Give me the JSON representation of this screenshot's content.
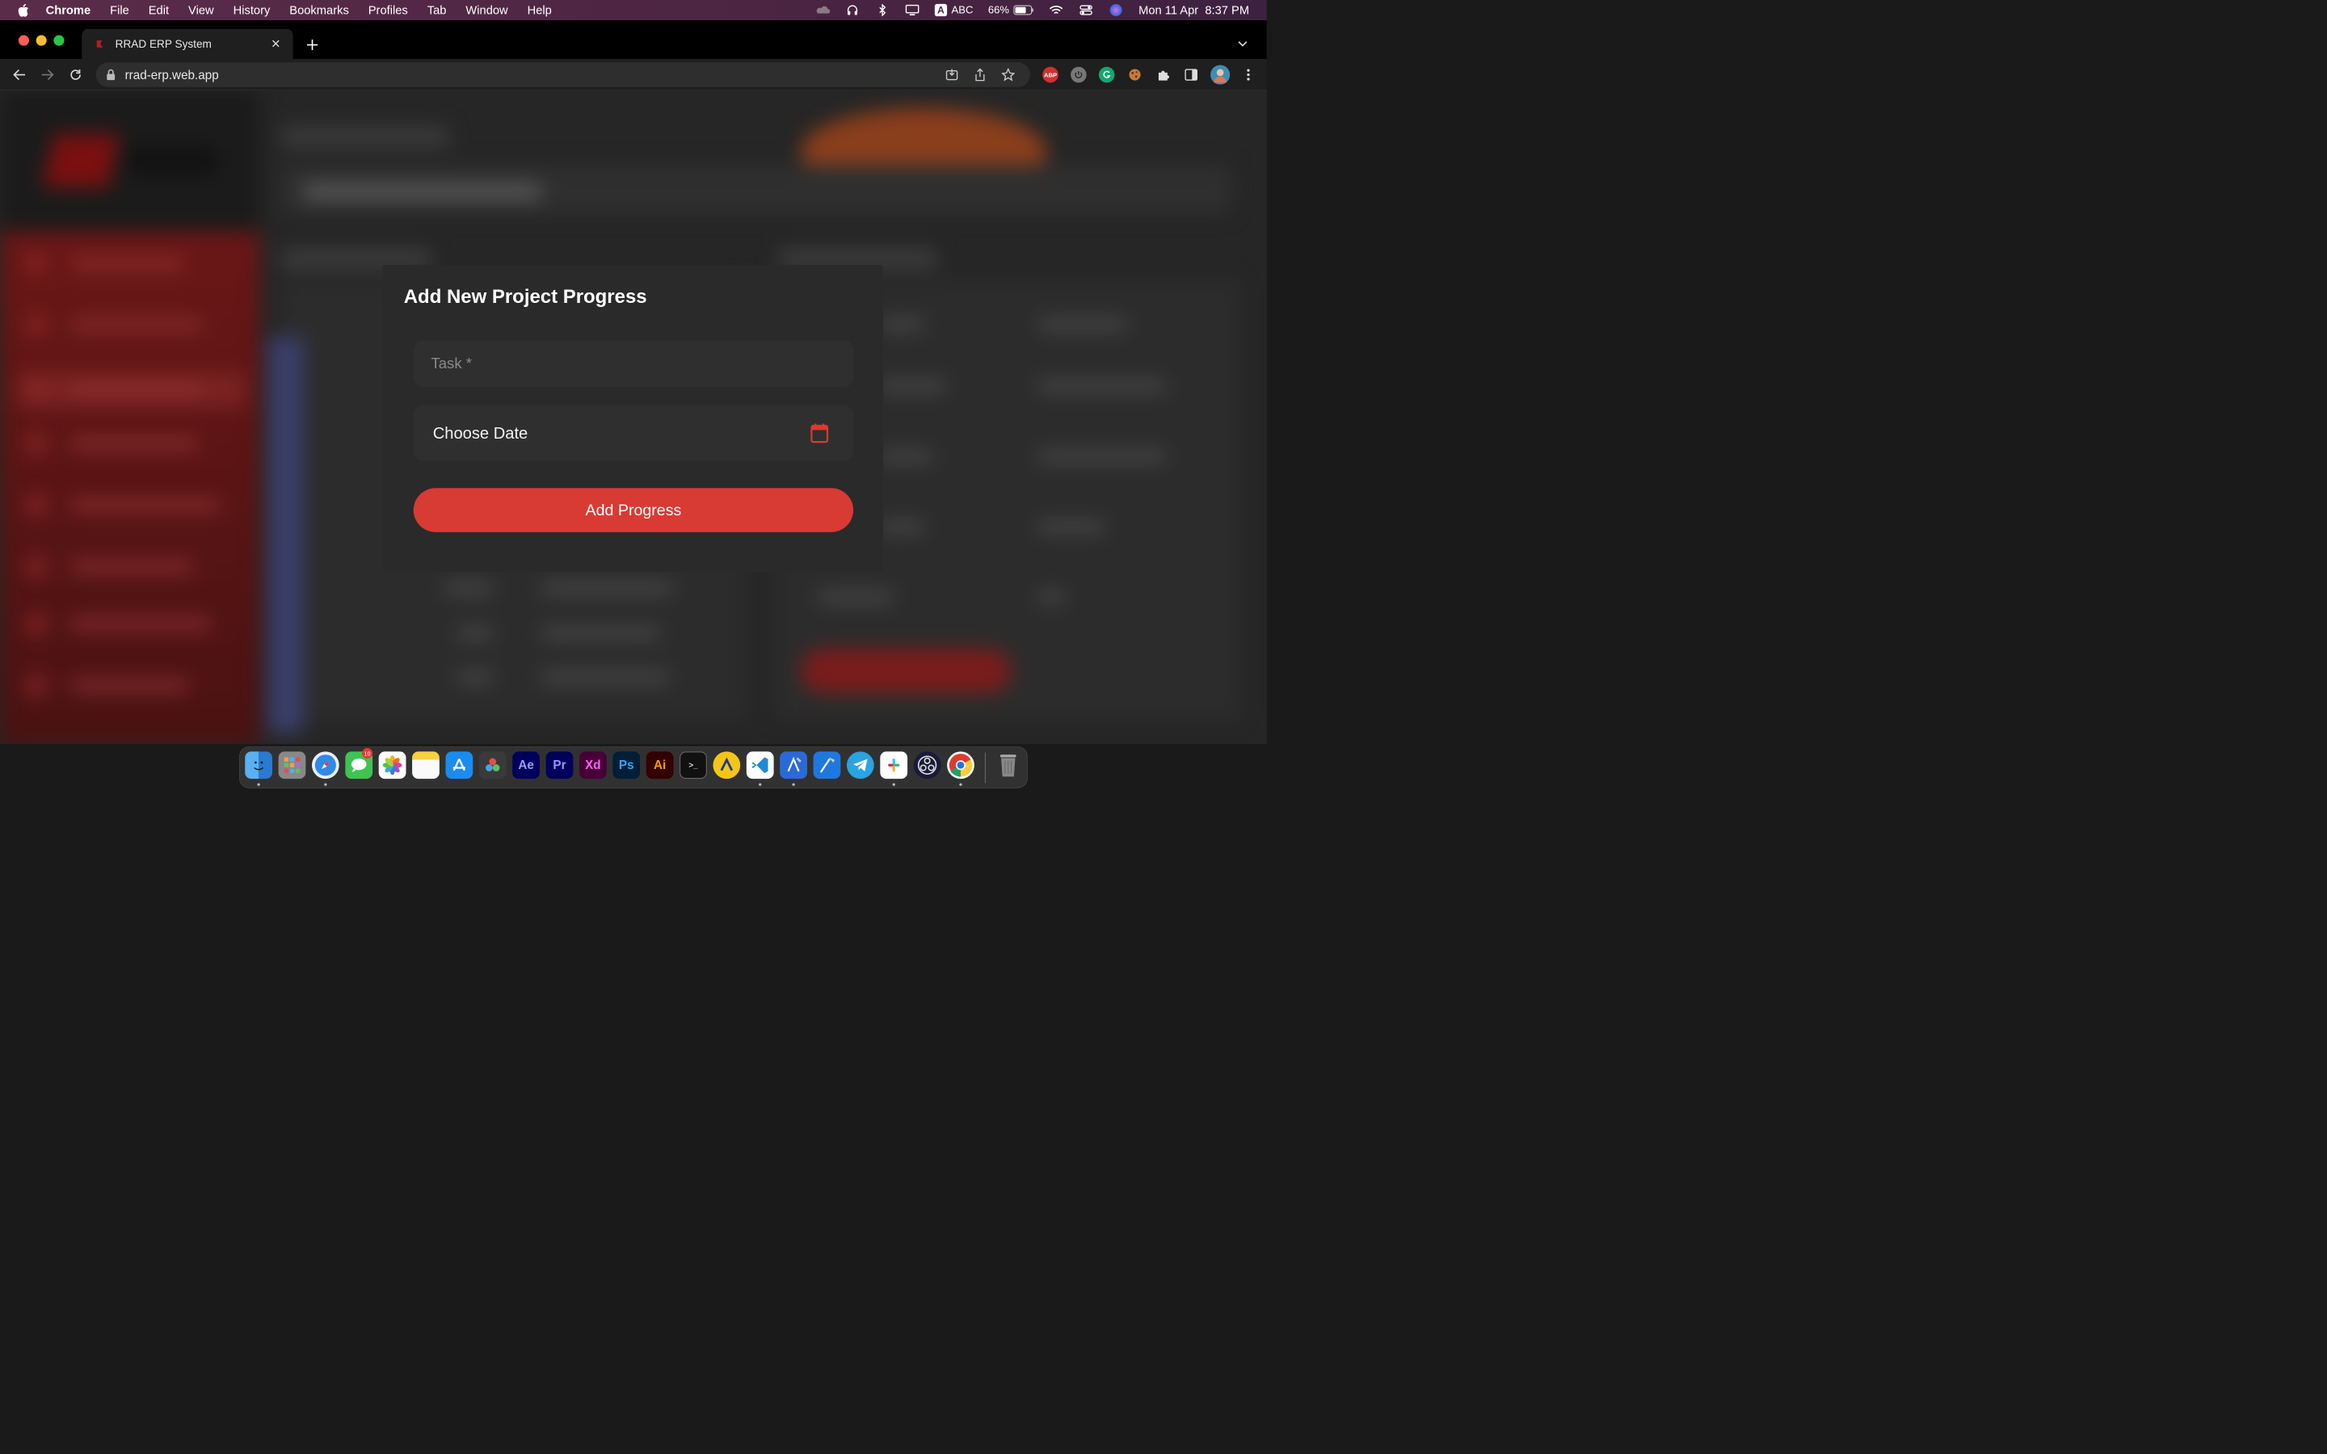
{
  "menubar": {
    "app_name": "Chrome",
    "items": [
      "File",
      "Edit",
      "View",
      "History",
      "Bookmarks",
      "Profiles",
      "Tab",
      "Window",
      "Help"
    ],
    "input_source": "ABC",
    "battery": "66%",
    "datetime": "Mon 11 Apr  8:37 PM"
  },
  "browser": {
    "tab_title": "RRAD ERP System",
    "url": "rrad-erp.web.app",
    "extensions": [
      "abp-icon",
      "power-icon",
      "grammarly-icon",
      "cookie-icon",
      "puzzle-icon",
      "sidepanel-icon",
      "profile-avatar",
      "more-icon"
    ],
    "abp_label": "ABP"
  },
  "modal": {
    "title": "Add New Project Progress",
    "task_placeholder": "Task *",
    "date_label": "Choose Date",
    "submit_label": "Add Progress"
  },
  "dock": {
    "apps": [
      {
        "name": "finder",
        "label": ""
      },
      {
        "name": "launchpad",
        "label": ""
      },
      {
        "name": "safari",
        "label": ""
      },
      {
        "name": "messages",
        "label": ""
      },
      {
        "name": "photos",
        "label": ""
      },
      {
        "name": "notes",
        "label": ""
      },
      {
        "name": "app-store",
        "label": ""
      },
      {
        "name": "davinci-resolve",
        "label": ""
      },
      {
        "name": "after-effects",
        "label": "Ae"
      },
      {
        "name": "premiere-pro",
        "label": "Pr"
      },
      {
        "name": "adobe-xd",
        "label": "Xd"
      },
      {
        "name": "photoshop",
        "label": "Ps"
      },
      {
        "name": "illustrator",
        "label": "Ai"
      },
      {
        "name": "terminal",
        "label": ">_"
      },
      {
        "name": "arc-app",
        "label": ""
      },
      {
        "name": "vscode",
        "label": ""
      },
      {
        "name": "xcode-instruments",
        "label": ""
      },
      {
        "name": "xcode",
        "label": ""
      },
      {
        "name": "telegram",
        "label": ""
      },
      {
        "name": "slack",
        "label": ""
      },
      {
        "name": "obs",
        "label": ""
      },
      {
        "name": "chrome",
        "label": ""
      },
      {
        "name": "trash",
        "label": ""
      }
    ],
    "messages_badge": "10"
  },
  "colors": {
    "accent": "#d83a34",
    "modal_bg": "#2a2a2a",
    "field_bg": "#2f2f2f"
  }
}
